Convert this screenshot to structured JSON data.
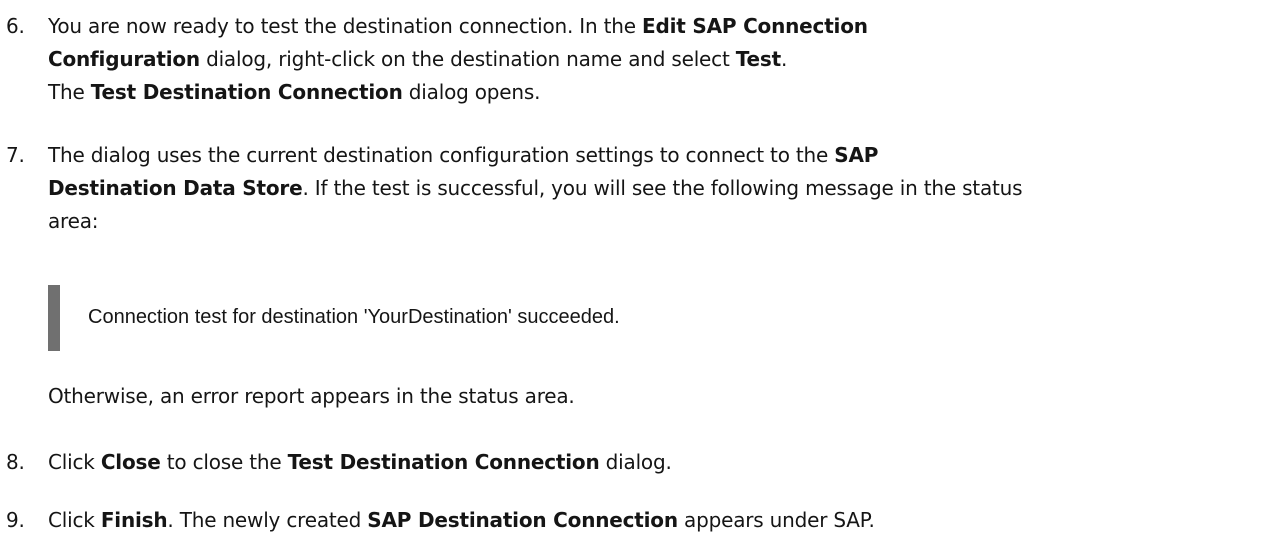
{
  "steps": [
    {
      "number": "6.",
      "lines": [
        {
          "t1": "You are now ready to test the destination connection. In the ",
          "b1": "Edit SAP Connection"
        },
        {
          "b1": "Configuration",
          "t1": " dialog, right-click on the destination name and select ",
          "b2": "Test",
          "t2": "."
        },
        {
          "t1": "The ",
          "b1": "Test Destination Connection",
          "t2": " dialog opens."
        }
      ]
    },
    {
      "number": "7.",
      "lines": [
        {
          "t1": "The dialog uses the current destination configuration settings to connect to the ",
          "b1": "SAP"
        },
        {
          "b1": "Destination Data Store",
          "t1": ". If the test is successful, you will see the following message in the status"
        },
        {
          "t1": "area:"
        }
      ],
      "quote": "Connection test for destination 'YourDestination' succeeded.",
      "after": "Otherwise, an error report appears in the status area."
    },
    {
      "number": "8.",
      "lines": [
        {
          "t1": "Click ",
          "b1": "Close",
          "t2": " to close the ",
          "b2": "Test Destination Connection",
          "t3": " dialog."
        }
      ]
    },
    {
      "number": "9.",
      "lines": [
        {
          "t1": "Click ",
          "b1": "Finish",
          "t2": ". The newly created ",
          "b2": "SAP Destination Connection",
          "t3": " appears under SAP."
        }
      ]
    }
  ]
}
